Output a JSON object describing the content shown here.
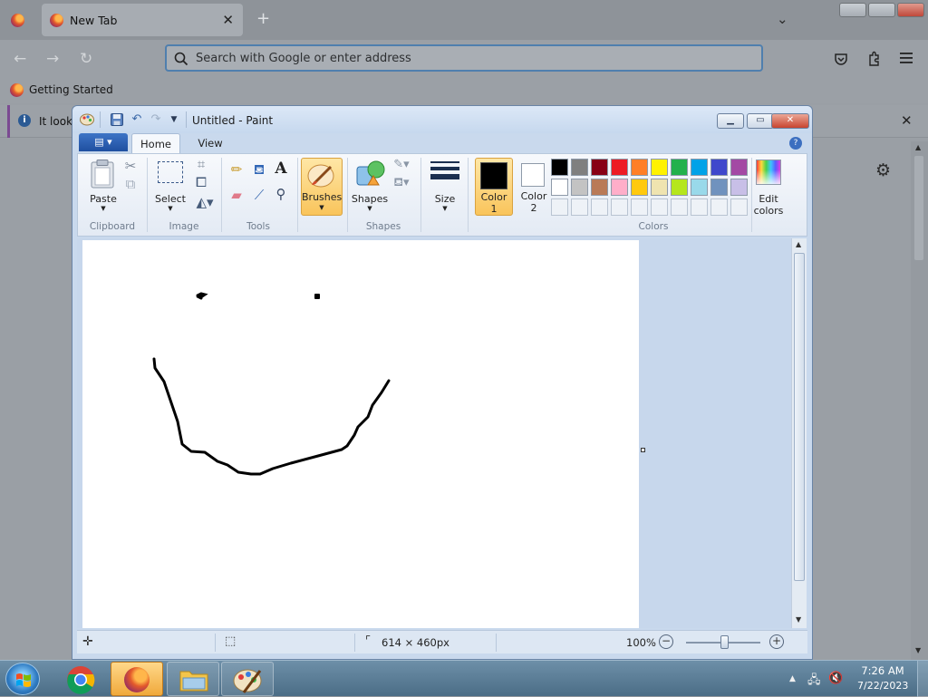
{
  "firefox": {
    "tab_title": "New Tab",
    "url_placeholder": "Search with Google or enter address",
    "bookmark": "Getting Started",
    "notice_text": "It look"
  },
  "paint": {
    "window_title": "Untitled - Paint",
    "tabs": {
      "home": "Home",
      "view": "View"
    },
    "groups": {
      "clipboard": "Clipboard",
      "image": "Image",
      "tools": "Tools",
      "shapes": "Shapes",
      "colors": "Colors"
    },
    "buttons": {
      "paste": "Paste",
      "select": "Select",
      "brushes": "Brushes",
      "shapes": "Shapes",
      "size": "Size",
      "color1_line1": "Color",
      "color1_line2": "1",
      "color2_line1": "Color",
      "color2_line2": "2",
      "edit_colors_line1": "Edit",
      "edit_colors_line2": "colors"
    },
    "color1": "#000000",
    "color2": "#ffffff",
    "palette_row1": [
      "#000000",
      "#7f7f7f",
      "#880015",
      "#ed1c24",
      "#ff7f27",
      "#fff200",
      "#22b14c",
      "#00a2e8",
      "#3f48cc",
      "#a349a4"
    ],
    "palette_row2": [
      "#ffffff",
      "#c3c3c3",
      "#b97a57",
      "#ffaec9",
      "#ffc90e",
      "#efe4b0",
      "#b5e61d",
      "#99d9ea",
      "#7092be",
      "#c8bfe7"
    ],
    "status": {
      "dimensions": "614 × 460px",
      "zoom": "100%"
    }
  },
  "taskbar": {
    "time": "7:26 AM",
    "date": "7/22/2023"
  }
}
